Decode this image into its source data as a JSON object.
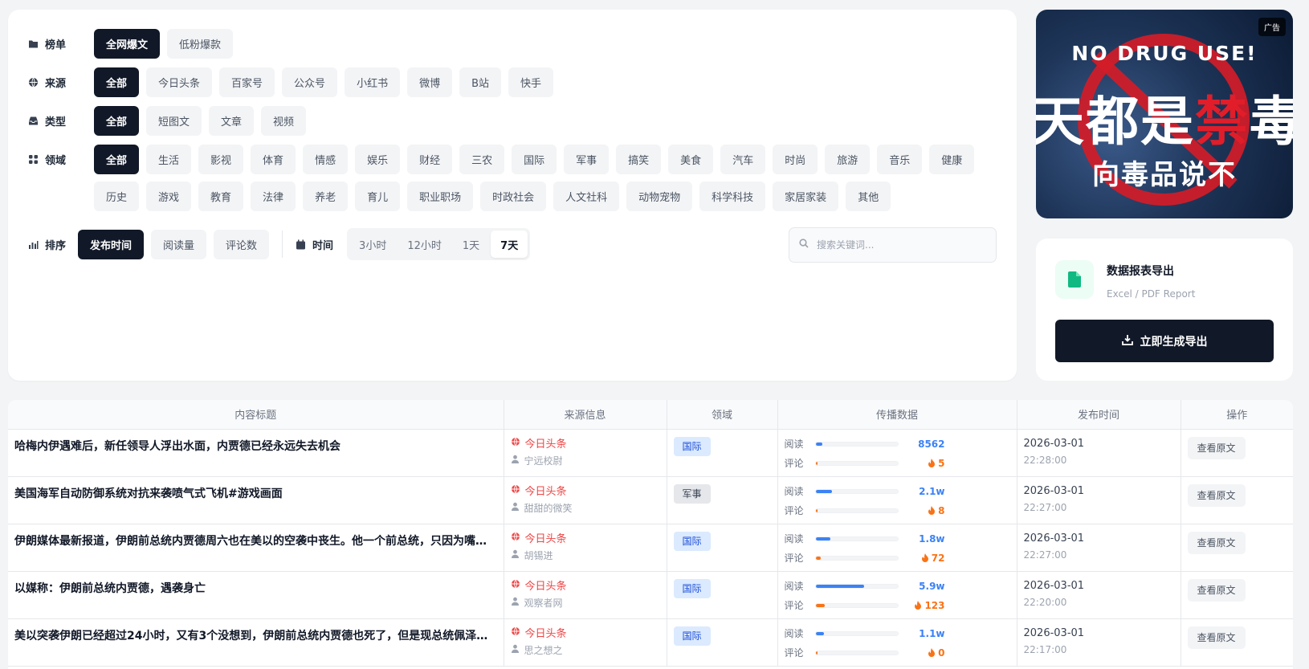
{
  "filters": {
    "rows": [
      {
        "label": "榜单",
        "icon": "folder-icon",
        "name": "list",
        "options": [
          "全网爆文",
          "低粉爆款"
        ],
        "active": 0
      },
      {
        "label": "来源",
        "icon": "globe-icon",
        "name": "source",
        "options": [
          "全部",
          "今日头条",
          "百家号",
          "公众号",
          "小红书",
          "微博",
          "B站",
          "快手"
        ],
        "active": 0
      },
      {
        "label": "类型",
        "icon": "inbox-icon",
        "name": "type",
        "options": [
          "全部",
          "短图文",
          "文章",
          "视频"
        ],
        "active": 0
      },
      {
        "label": "领域",
        "icon": "grid-icon",
        "name": "domain",
        "options": [
          "全部",
          "生活",
          "影视",
          "体育",
          "情感",
          "娱乐",
          "财经",
          "三农",
          "国际",
          "军事",
          "搞笑",
          "美食",
          "汽车",
          "时尚",
          "旅游",
          "音乐",
          "健康",
          "历史",
          "游戏",
          "教育",
          "法律",
          "养老",
          "育儿",
          "职业职场",
          "时政社会",
          "人文社科",
          "动物宠物",
          "科学科技",
          "家居家装",
          "其他"
        ],
        "active": 0
      }
    ],
    "sort": {
      "label": "排序",
      "icon": "chart-icon",
      "options": [
        "发布时间",
        "阅读量",
        "评论数"
      ],
      "active": 0
    },
    "time": {
      "label": "时间",
      "icon": "calendar-icon",
      "options": [
        "3小时",
        "12小时",
        "1天",
        "7天"
      ],
      "active": 3
    },
    "search": {
      "placeholder": "搜索关键词...",
      "value": ""
    }
  },
  "ad": {
    "badge": "广告",
    "line1": "NO DRUG USE!",
    "line2a": "天都是",
    "line2b": "禁",
    "line2c": "毒",
    "line3": "向毒品说不"
  },
  "export": {
    "title": "数据报表导出",
    "subtitle": "Excel / PDF Report",
    "button": "立即生成导出",
    "accent": "#10b981"
  },
  "table": {
    "headers": [
      "内容标题",
      "来源信息",
      "领域",
      "传播数据",
      "发布时间",
      "操作"
    ],
    "read_label": "阅读",
    "comment_label": "评论",
    "action_label": "查看原文",
    "rows": [
      {
        "title": "哈梅内伊遇难后，新任领导人浮出水面，内贾德已经永远失去机会",
        "source": "今日头条",
        "author": "宁远校尉",
        "domain": "国际",
        "domain_style": "blue",
        "reads": "8562",
        "read_pct": 0.08,
        "comments": "5",
        "comment_pct": 0.01,
        "date": "2026-03-01",
        "time": "22:28:00"
      },
      {
        "title": "美国海军自动防御系统对抗来袭喷气式飞机#游戏画面",
        "source": "今日头条",
        "author": "甜甜的微笑",
        "domain": "军事",
        "domain_style": "gray",
        "reads": "2.1w",
        "read_pct": 0.2,
        "comments": "8",
        "comment_pct": 0.01,
        "date": "2026-03-01",
        "time": "22:27:00"
      },
      {
        "title": "伊朗媒体最新报道，伊朗前总统内贾德周六也在美以的空袭中丧生。他一个前总统，只因为嘴硬就被美以斩首",
        "source": "今日头条",
        "author": "胡锡进",
        "domain": "国际",
        "domain_style": "blue",
        "reads": "1.8w",
        "read_pct": 0.18,
        "comments": "72",
        "comment_pct": 0.06,
        "date": "2026-03-01",
        "time": "22:27:00"
      },
      {
        "title": "以媒称：伊朗前总统内贾德，遇袭身亡",
        "source": "今日头条",
        "author": "观察者网",
        "domain": "国际",
        "domain_style": "blue",
        "reads": "5.9w",
        "read_pct": 0.59,
        "comments": "123",
        "comment_pct": 0.11,
        "date": "2026-03-01",
        "time": "22:20:00"
      },
      {
        "title": "美以突袭伊朗已经超过24小时，又有3个没想到，伊朗前总统内贾德也死了，但是现总统佩泽希齐扬还活着",
        "source": "今日头条",
        "author": "思之想之",
        "domain": "国际",
        "domain_style": "blue",
        "reads": "1.1w",
        "read_pct": 0.1,
        "comments": "0",
        "comment_pct": 0.0,
        "date": "2026-03-01",
        "time": "22:17:00"
      }
    ]
  }
}
